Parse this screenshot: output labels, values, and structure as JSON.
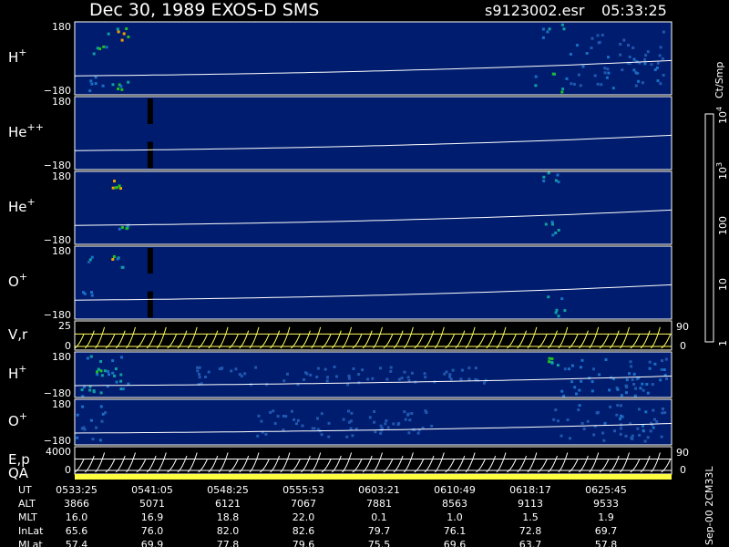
{
  "header": {
    "title": "Dec 30, 1989    EXOS-D SMS",
    "filename": "s9123002.esr",
    "time": "05:33:25"
  },
  "chart_data": {
    "type": "heatmap",
    "panels": [
      {
        "id": "hplus1",
        "label": "H",
        "sup": "+",
        "ymax": "180",
        "ymin": "−180",
        "kind": "heat",
        "patches": [
          [
            0.03,
            0.06,
            0.05,
            0.45,
            0.8
          ],
          [
            0.06,
            0.09,
            0.05,
            0.25,
            0.9
          ],
          [
            0.06,
            0.09,
            0.8,
            0.95,
            0.7
          ],
          [
            0.015,
            0.05,
            0.7,
            0.95,
            0.5
          ],
          [
            0.78,
            0.82,
            0.0,
            0.2,
            0.7
          ],
          [
            0.77,
            0.82,
            0.65,
            0.98,
            0.8
          ],
          [
            0.82,
            0.86,
            0.3,
            0.9,
            0.4
          ],
          [
            0.86,
            0.99,
            0.1,
            0.9,
            0.3
          ],
          [
            0.9,
            0.98,
            0.3,
            0.7,
            0.35
          ]
        ]
      },
      {
        "id": "heplusplus",
        "label": "He",
        "sup": "++",
        "ymax": "180",
        "ymin": "−180",
        "kind": "heat",
        "gaps": true,
        "patches": []
      },
      {
        "id": "heplus",
        "label": "He",
        "sup": "+",
        "ymax": "180",
        "ymin": "−180",
        "kind": "heat",
        "patches": [
          [
            0.06,
            0.08,
            0.08,
            0.22,
            0.9
          ],
          [
            0.06,
            0.09,
            0.72,
            0.85,
            0.8
          ],
          [
            0.78,
            0.81,
            0.0,
            0.18,
            0.6
          ],
          [
            0.78,
            0.81,
            0.65,
            0.9,
            0.7
          ]
        ]
      },
      {
        "id": "oplus1",
        "label": "O",
        "sup": "+",
        "ymax": "180",
        "ymin": "−180",
        "kind": "heat",
        "gaps": true,
        "patches": [
          [
            0.0,
            0.03,
            0.1,
            0.75,
            0.5
          ],
          [
            0.06,
            0.08,
            0.12,
            0.28,
            0.9
          ],
          [
            0.79,
            0.82,
            0.65,
            0.95,
            0.7
          ]
        ]
      },
      {
        "id": "vr",
        "label": "V,r",
        "sup": "",
        "ymax": "25",
        "ymin": "0",
        "rmax": "90",
        "rmin": "0",
        "kind": "hatch",
        "color": "#ffff60"
      },
      {
        "id": "hplus2",
        "label": "H",
        "sup": "+",
        "ymax": "180",
        "ymin": "−180",
        "kind": "heat",
        "patches": [
          [
            0.01,
            0.09,
            0.05,
            0.95,
            0.6
          ],
          [
            0.03,
            0.05,
            0.1,
            0.6,
            0.9
          ],
          [
            0.79,
            0.81,
            0.1,
            0.35,
            0.9
          ],
          [
            0.81,
            0.99,
            0.1,
            0.95,
            0.45
          ],
          [
            0.2,
            0.7,
            0.3,
            0.7,
            0.15
          ]
        ]
      },
      {
        "id": "oplus2",
        "label": "O",
        "sup": "+",
        "ymax": "180",
        "ymin": "−180",
        "kind": "heat",
        "patches": [
          [
            0.0,
            0.05,
            0.1,
            0.9,
            0.4
          ],
          [
            0.3,
            0.6,
            0.2,
            0.8,
            0.12
          ],
          [
            0.8,
            0.99,
            0.1,
            0.9,
            0.3
          ]
        ]
      },
      {
        "id": "ep",
        "label": "E,p",
        "sup": "",
        "ymax": "4000",
        "ymin": "0",
        "rmax": "90",
        "rmin": "0",
        "kind": "hatch",
        "color": "#ffffff"
      }
    ],
    "qa_label": "QA",
    "colorbar": {
      "unit": "Ct/Smp",
      "ticks": [
        {
          "label": "10",
          "sup": "4",
          "value": 4
        },
        {
          "label": "10",
          "sup": "3",
          "value": 3
        },
        {
          "label": "100",
          "sup": "",
          "value": 2
        },
        {
          "label": "10",
          "sup": "",
          "value": 1
        },
        {
          "label": "1",
          "sup": "",
          "value": 0
        }
      ]
    },
    "table": {
      "rows": [
        {
          "label": "UT",
          "values": [
            "0533:25",
            "0541:05",
            "0548:25",
            "0555:53",
            "0603:21",
            "0610:49",
            "0618:17",
            "0625:45"
          ]
        },
        {
          "label": "ALT",
          "values": [
            "3866",
            "5071",
            "6121",
            "7067",
            "7881",
            "8563",
            "9113",
            "9533"
          ]
        },
        {
          "label": "MLT",
          "values": [
            "16.0",
            "16.9",
            "18.8",
            "22.0",
            "0.1",
            "1.0",
            "1.5",
            "1.9"
          ]
        },
        {
          "label": "InLat",
          "values": [
            "65.6",
            "76.0",
            "82.0",
            "82.6",
            "79.7",
            "76.1",
            "72.8",
            "69.7"
          ]
        },
        {
          "label": "MLat",
          "values": [
            "57.4",
            "69.9",
            "77.8",
            "79.6",
            "75.5",
            "69.6",
            "63.7",
            "57.8"
          ]
        }
      ]
    },
    "footer_note": "Sep-00  2CM33L"
  }
}
